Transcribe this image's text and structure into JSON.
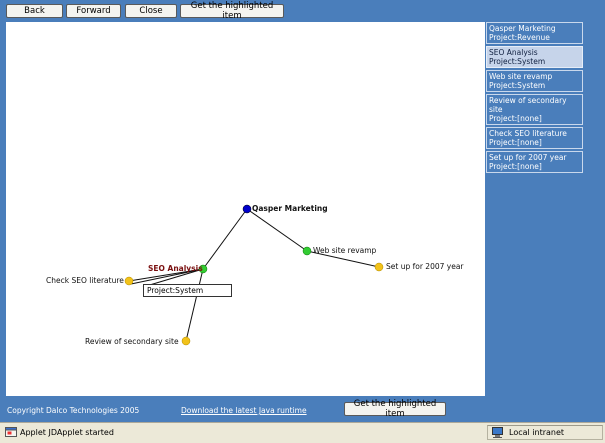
{
  "toolbar": {
    "back": "Back",
    "forward": "Forward",
    "close": "Close",
    "get_highlighted": "Get the highlighted item"
  },
  "graph": {
    "root": "Qasper Marketing",
    "nodes": {
      "seo": "SEO Analysis",
      "web": "Web site revamp",
      "setup": "Set up for 2007 year",
      "check": "Check SEO literature",
      "review": "Review of secondary site"
    },
    "tooltip": "Project:System",
    "colors": {
      "root": "#0000cc",
      "mid": "#33cc33",
      "leaf": "#f2c21a"
    }
  },
  "sidebar": {
    "items": [
      {
        "name": "Qasper Marketing",
        "project": "Project:Revenue"
      },
      {
        "name": "SEO Analysis",
        "project": "Project:System"
      },
      {
        "name": "Web site revamp",
        "project": "Project:System"
      },
      {
        "name": "Review of secondary site",
        "project": "Project:[none]"
      },
      {
        "name": "Check SEO literature",
        "project": "Project:[none]"
      },
      {
        "name": "Set up for 2007 year",
        "project": "Project:[none]"
      }
    ]
  },
  "footer": {
    "copyright": "Copyright Dalco Technologies 2005",
    "download_link": "Download the latest Java runtime",
    "get_highlighted": "Get the highlighted item"
  },
  "status": {
    "text": "Applet JDApplet started",
    "zone": "Local intranet"
  }
}
